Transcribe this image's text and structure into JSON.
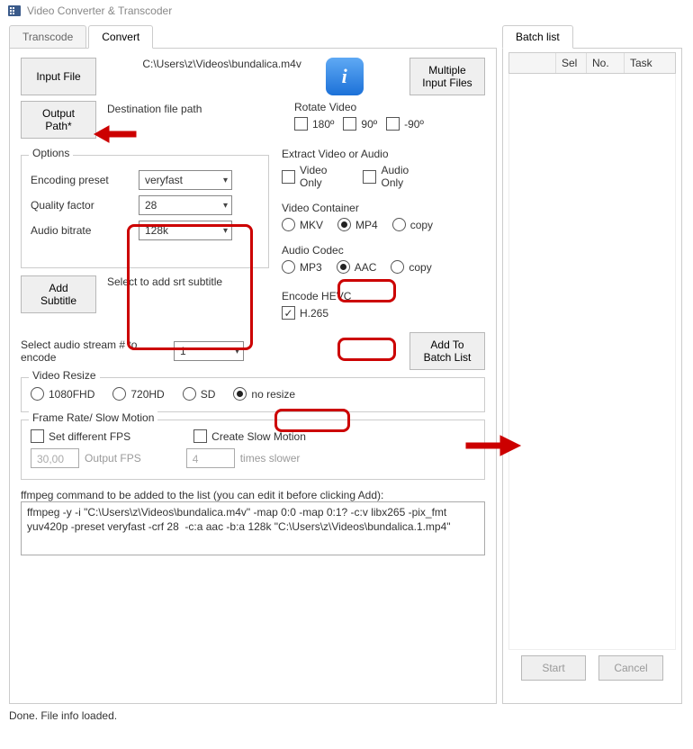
{
  "window": {
    "title": "Video Converter & Transcoder"
  },
  "tabs": {
    "transcode": "Transcode",
    "convert": "Convert",
    "batch": "Batch list"
  },
  "buttons": {
    "input_file": "Input File",
    "output_path": "Output\nPath*",
    "multiple_input": "Multiple\nInput Files",
    "add_subtitle": "Add\nSubtitle",
    "add_to_batch": "Add To\nBatch List",
    "start": "Start",
    "cancel": "Cancel"
  },
  "paths": {
    "input": "C:\\Users\\z\\Videos\\bundalica.m4v",
    "dest_label": "Destination file path"
  },
  "options": {
    "group_title": "Options",
    "preset_label": "Encoding preset",
    "preset_value": "veryfast",
    "quality_label": "Quality factor",
    "quality_value": "28",
    "audio_bitrate_label": "Audio bitrate",
    "audio_bitrate_value": "128k"
  },
  "subtitle_hint": "Select to add srt subtitle",
  "rotate": {
    "title": "Rotate Video",
    "o180": "180º",
    "o90": "90º",
    "om90": "-90º"
  },
  "extract": {
    "title": "Extract Video or Audio",
    "video_only": "Video\nOnly",
    "audio_only": "Audio\nOnly"
  },
  "container": {
    "title": "Video Container",
    "mkv": "MKV",
    "mp4": "MP4",
    "copy": "copy",
    "selected": "mp4"
  },
  "acodec": {
    "title": "Audio Codec",
    "mp3": "MP3",
    "aac": "AAC",
    "copy": "copy",
    "selected": "aac"
  },
  "hevc": {
    "title": "Encode HEVC",
    "label": "H.265",
    "checked": true
  },
  "audio_stream": {
    "label": "Select audio stream # to encode",
    "value": "1"
  },
  "resize": {
    "title": "Video Resize",
    "o1080": "1080FHD",
    "o720": "720HD",
    "osd": "SD",
    "ono": "no resize",
    "selected": "no"
  },
  "fps": {
    "title": "Frame Rate/ Slow Motion",
    "set_fps_label": "Set different FPS",
    "create_slomo_label": "Create Slow Motion",
    "fps_value": "30,00",
    "fps_placeholder": "Output FPS",
    "slomo_value": "4",
    "slomo_placeholder": "times slower"
  },
  "ffmpeg": {
    "label": "ffmpeg command to be added to the list (you can edit it before clicking Add):",
    "value": "ffmpeg -y -i \"C:\\Users\\z\\Videos\\bundalica.m4v\" -map 0:0 -map 0:1? -c:v libx265 -pix_fmt yuv420p -preset veryfast -crf 28  -c:a aac -b:a 128k \"C:\\Users\\z\\Videos\\bundalica.1.mp4\""
  },
  "batch": {
    "columns": [
      "",
      "Sel",
      "No.",
      "Task"
    ]
  },
  "status": "Done. File info loaded."
}
